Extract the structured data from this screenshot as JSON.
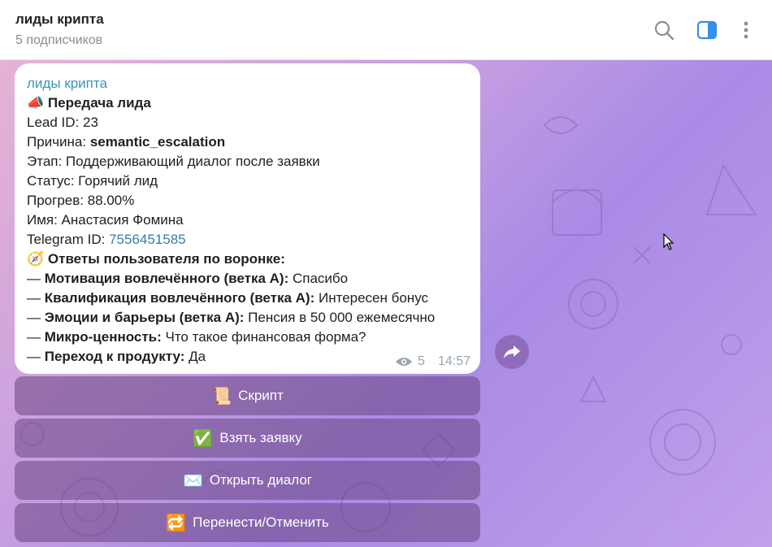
{
  "header": {
    "title": "лиды крипта",
    "subtitle": "5 подписчиков"
  },
  "message": {
    "sender": "лиды крипта",
    "heading_emoji": "📣",
    "heading": "Передача лида",
    "lead_id": "Lead ID: 23",
    "reason_label": "Причина: ",
    "reason_value": "semantic_escalation",
    "stage": "Этап: Поддерживающий диалог после заявки",
    "status": "Статус: Горячий лид",
    "warmup": "Прогрев: 88.00%",
    "name": "Имя: Анастасия Фомина",
    "telegram_label": "Telegram ID: ",
    "telegram_id": "7556451585",
    "answers_emoji": "🧭",
    "answers_heading": "Ответы пользователя по воронке:",
    "answers": [
      {
        "q": "Мотивация вовлечённого (ветка A):",
        "a": " Спасибо"
      },
      {
        "q": "Квалификация вовлечённого (ветка A):",
        "a": " Интересен бонус"
      },
      {
        "q": "Эмоции и барьеры (ветка A):",
        "a": " Пенсия в 50 000 ежемесячно"
      },
      {
        "q": "Микро-ценность:",
        "a": " Что  такое финансовая форма?"
      },
      {
        "q": "Переход к продукту:",
        "a": " Да"
      }
    ],
    "dash": "— ",
    "views": "5",
    "time": "14:57"
  },
  "buttons": [
    {
      "emoji": "📜",
      "label": "Скрипт"
    },
    {
      "emoji": "✅",
      "label": "Взять заявку"
    },
    {
      "emoji": "✉️",
      "label": "Открыть диалог"
    },
    {
      "emoji": "🔁",
      "label": "Перенести/Отменить"
    }
  ],
  "icons": {
    "search": "search-icon",
    "sidebar": "sidebar-toggle-icon",
    "more": "more-vertical-icon",
    "share": "share-icon",
    "views": "eye-icon"
  },
  "colors": {
    "accent": "#3a95b5",
    "sidebar_icon": "#3390ec",
    "button_bg": "#6a4682"
  }
}
